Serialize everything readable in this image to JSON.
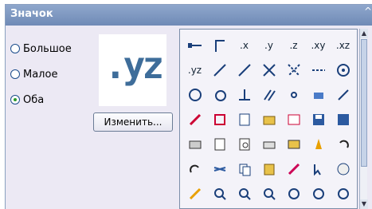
{
  "panel": {
    "title": "Значок",
    "collapse_glyph": "^"
  },
  "size_options": [
    {
      "label": "Большое",
      "selected": false
    },
    {
      "label": "Малое",
      "selected": false
    },
    {
      "label": "Оба",
      "selected": true
    }
  ],
  "preview": {
    "text": ".yz"
  },
  "change_button": {
    "label": "Изменить..."
  },
  "icon_grid": {
    "rows": [
      [
        {
          "name": "line-endpoint-icon"
        },
        {
          "name": "corner-angle-icon"
        },
        {
          "text": ".x",
          "name": "x-filter-icon"
        },
        {
          "text": ".y",
          "name": "y-filter-icon"
        },
        {
          "text": ".z",
          "name": "z-filter-icon"
        },
        {
          "text": ".xy",
          "name": "xy-filter-icon"
        },
        {
          "text": ".xz",
          "name": "xz-filter-icon"
        }
      ],
      [
        {
          "text": ".yz",
          "name": "yz-filter-icon"
        },
        {
          "name": "snap-midpoint-icon"
        },
        {
          "name": "snap-line-icon"
        },
        {
          "name": "snap-intersection-icon"
        },
        {
          "name": "snap-apparent-intersection-icon"
        },
        {
          "name": "snap-extension-icon"
        },
        {
          "name": "snap-center-icon"
        }
      ],
      [
        {
          "name": "snap-quadrant-icon"
        },
        {
          "name": "snap-tangent-icon"
        },
        {
          "name": "snap-perpendicular-icon"
        },
        {
          "name": "snap-parallel-icon"
        },
        {
          "name": "snap-node-icon"
        },
        {
          "name": "snap-insert-icon"
        },
        {
          "name": "snap-nearest-icon"
        }
      ],
      [
        {
          "name": "snap-none-icon"
        },
        {
          "name": "osnap-settings-icon"
        },
        {
          "name": "new-file-icon"
        },
        {
          "name": "open-file-icon"
        },
        {
          "name": "sheet-set-icon"
        },
        {
          "name": "save-icon"
        },
        {
          "name": "save-as-icon"
        }
      ],
      [
        {
          "name": "plot-icon"
        },
        {
          "name": "page-setup-icon"
        },
        {
          "name": "plot-preview-icon"
        },
        {
          "name": "print-icon"
        },
        {
          "name": "publish-icon"
        },
        {
          "name": "purge-icon"
        },
        {
          "name": "undo-icon"
        }
      ],
      [
        {
          "name": "redo-icon"
        },
        {
          "name": "cut-icon"
        },
        {
          "name": "copy-icon"
        },
        {
          "name": "paste-icon"
        },
        {
          "name": "match-properties-icon"
        },
        {
          "name": "select-icon"
        },
        {
          "name": "spell-check-icon"
        }
      ],
      [
        {
          "name": "pencil-icon"
        },
        {
          "name": "zoom-in-icon"
        },
        {
          "name": "zoom-realtime-icon"
        },
        {
          "name": "zoom-window-icon"
        },
        {
          "name": "zoom-extents-icon"
        },
        {
          "name": "zoom-all-icon"
        },
        {
          "name": "zoom-previous-icon"
        }
      ]
    ]
  },
  "colors": {
    "title_bar": "#7b95c0",
    "accent_blue": "#2c5aa0",
    "preview_text": "#3e6d9a"
  }
}
